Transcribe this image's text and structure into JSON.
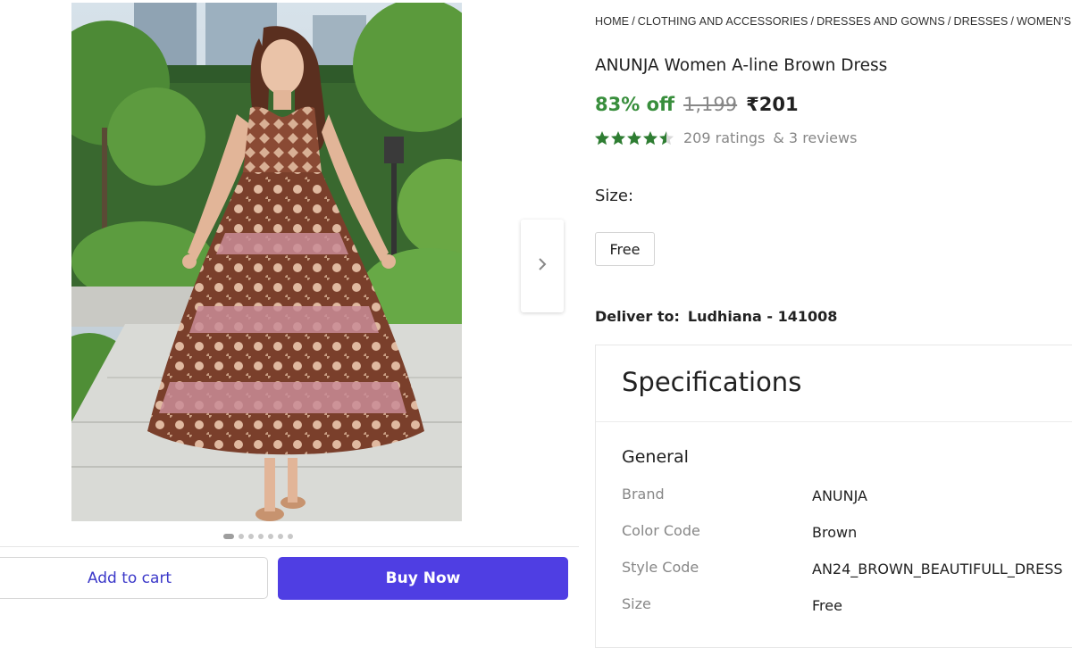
{
  "breadcrumb": [
    "HOME",
    "CLOTHING AND ACCESSORIES",
    "DRESSES AND GOWNS",
    "DRESSES",
    "WOMEN'S DRESSES"
  ],
  "breadcrumb_separator": "/",
  "product": {
    "title": "ANUNJA Women A-line Brown Dress",
    "discount": "83% off",
    "mrp": "1,199",
    "price": "₹201",
    "rating_stars": 4.5,
    "ratings_text": "209 ratings",
    "reviews_text": "& 3 reviews"
  },
  "size": {
    "label": "Size:",
    "options": [
      "Free"
    ]
  },
  "delivery": {
    "label": "Deliver to:",
    "location": "Ludhiana - 141008"
  },
  "specifications": {
    "title": "Specifications",
    "section": "General",
    "rows": [
      {
        "key": "Brand",
        "value": "ANUNJA"
      },
      {
        "key": "Color Code",
        "value": "Brown"
      },
      {
        "key": "Style Code",
        "value": "AN24_BROWN_BEAUTIFULL_DRESS"
      },
      {
        "key": "Size",
        "value": "Free"
      }
    ]
  },
  "gallery": {
    "image_count": 7,
    "active_index": 0,
    "next_icon": "chevron-right-icon"
  },
  "actions": {
    "add_to_cart": "Add to cart",
    "buy_now": "Buy Now"
  },
  "colors": {
    "discount_green": "#388e3c",
    "star_green": "#2e7d32",
    "buy_button": "#4f3ee3",
    "cart_text": "#3b38c9"
  }
}
